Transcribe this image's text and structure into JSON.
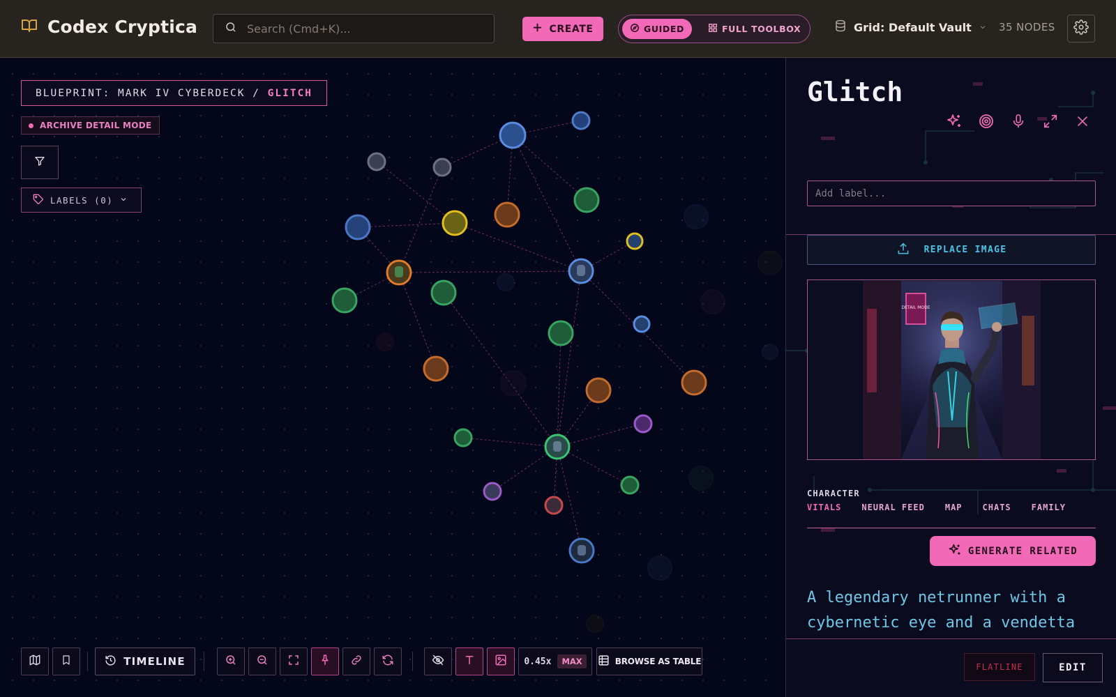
{
  "app": {
    "name": "Codex Cryptica",
    "search_placeholder": "Search (Cmd+K)...",
    "create_label": "CREATE",
    "mode_guided": "GUIDED",
    "mode_full": "FULL TOOLBOX",
    "vault_label": "Grid: Default Vault",
    "node_count": "35 NODES",
    "accent_color": "#f26ab7"
  },
  "canvas": {
    "breadcrumb_prefix": "BLUEPRINT: MARK IV CYBERDECK / ",
    "breadcrumb_current": "GLITCH",
    "archive_mode": "ARCHIVE DETAIL MODE",
    "labels_button": "LABELS (0)",
    "toolbar": {
      "timeline": "TIMELINE",
      "zoom_value": "0.45x",
      "zoom_badge": "MAX",
      "browse_table": "BROWSE AS TABLE"
    }
  },
  "panel": {
    "title": "Glitch",
    "label_placeholder": "Add label...",
    "replace_image": "REPLACE IMAGE",
    "entity_type": "CHARACTER",
    "tabs": [
      "VITALS",
      "NEURAL FEED",
      "MAP",
      "CHATS",
      "FAMILY"
    ],
    "generate_related": "GENERATE RELATED",
    "description": "A legendary netrunner with a cybernetic eye and a vendetta",
    "flatline": "FLATLINE",
    "edit": "EDIT",
    "poster_text": "DETAIL MODE"
  }
}
